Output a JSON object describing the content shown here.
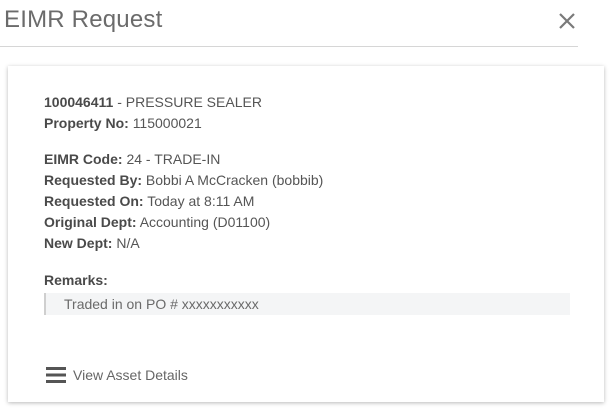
{
  "modal": {
    "title": "EIMR Request",
    "close_icon": "close-icon"
  },
  "asset": {
    "number": "100046411",
    "separator": " - ",
    "name": "PRESSURE SEALER",
    "property_label": "Property No:",
    "property_value": "115000021"
  },
  "details": {
    "code_label": "EIMR Code:",
    "code_value": "24 - TRADE-IN",
    "requested_by_label": "Requested By:",
    "requested_by_value": "Bobbi A McCracken (bobbib)",
    "requested_on_label": "Requested On:",
    "requested_on_value": "Today at 8:11 AM",
    "original_dept_label": "Original Dept:",
    "original_dept_value": "Accounting (D01100)",
    "new_dept_label": "New Dept:",
    "new_dept_value": "N/A"
  },
  "remarks": {
    "label": "Remarks:",
    "text": "Traded in on PO # xxxxxxxxxxx"
  },
  "actions": {
    "view_asset_icon": "list-icon",
    "view_asset_label": "View Asset Details"
  },
  "colors": {
    "title": "#6b6b6b",
    "text": "#555555",
    "label": "#4a4a4a",
    "divider": "#d6d6d6",
    "remarks_bg": "#f4f5f6"
  }
}
